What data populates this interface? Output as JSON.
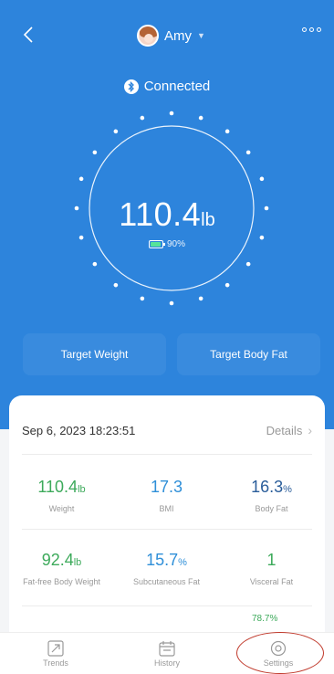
{
  "header": {
    "user_name": "Amy",
    "connection_status": "Connected"
  },
  "scale": {
    "weight_value": "110.4",
    "weight_unit": "lb",
    "battery": "90%"
  },
  "targets": {
    "target_weight": "Target Weight",
    "target_body_fat": "Target Body Fat"
  },
  "record": {
    "timestamp": "Sep 6, 2023 18:23:51",
    "details_label": "Details",
    "metrics": [
      {
        "value": "110.4",
        "unit": "lb",
        "label": "Weight"
      },
      {
        "value": "17.3",
        "unit": "",
        "label": "BMI"
      },
      {
        "value": "16.3",
        "unit": "%",
        "label": "Body Fat"
      },
      {
        "value": "92.4",
        "unit": "lb",
        "label": "Fat-free Body Weight"
      },
      {
        "value": "15.7",
        "unit": "%",
        "label": "Subcutaneous Fat"
      },
      {
        "value": "1",
        "unit": "",
        "label": "Visceral Fat"
      }
    ],
    "partial_value": "78.7%"
  },
  "tabs": [
    {
      "label": "Trends",
      "icon": "trends-icon"
    },
    {
      "label": "History",
      "icon": "calendar-icon"
    },
    {
      "label": "Settings",
      "icon": "settings-icon"
    }
  ],
  "colors": {
    "primary_blue": "#2d84dc",
    "value_green": "#3daa5b",
    "value_blue": "#2f8fd8",
    "value_navy": "#2a5d9a",
    "annotation_red": "#c0392b"
  }
}
